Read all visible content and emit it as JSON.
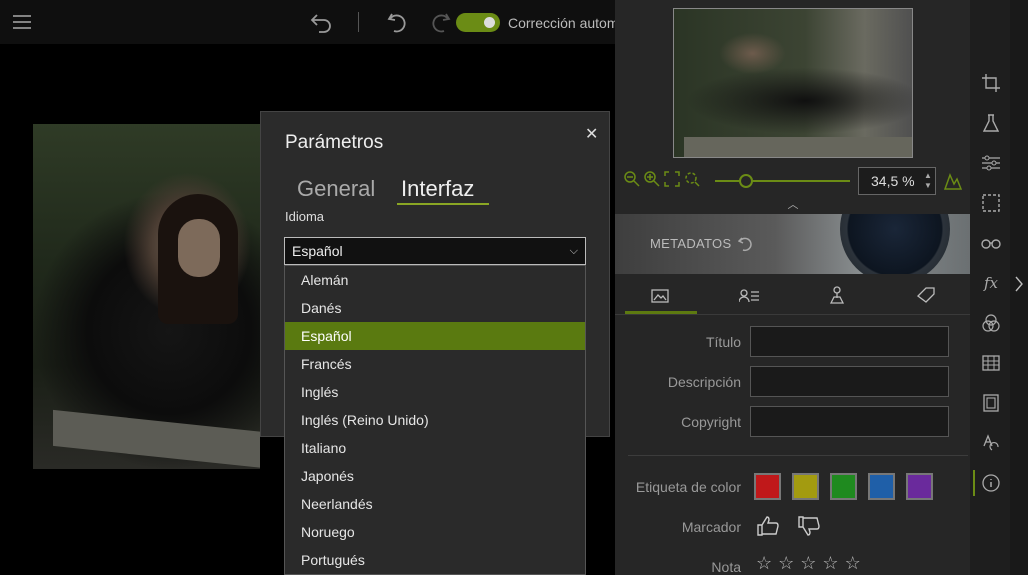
{
  "toolbar": {
    "auto_correction_label": "Corrección autom",
    "auto_correction_on": true,
    "accent": "#6b8c15"
  },
  "navigator": {
    "zoom_value": "34,5 %"
  },
  "metadata": {
    "banner_label": "METADATOS",
    "fields": [
      {
        "label": "Título",
        "value": ""
      },
      {
        "label": "Descripción",
        "value": ""
      },
      {
        "label": "Copyright",
        "value": ""
      }
    ],
    "color_label_title": "Etiqueta de color",
    "color_labels": [
      "#c0181a",
      "#a39b10",
      "#1f8a1f",
      "#1f5fa8",
      "#6a2a9c"
    ],
    "marker_label": "Marcador",
    "rating_label": "Nota",
    "rating_stars": 5
  },
  "dialog": {
    "title": "Parámetros",
    "tabs": [
      {
        "label": "General",
        "active": false
      },
      {
        "label": "Interfaz",
        "active": true
      }
    ],
    "language_label": "Idioma",
    "language_selected": "Español",
    "language_options": [
      "Alemán",
      "Danés",
      "Español",
      "Francés",
      "Inglés",
      "Inglés (Reino Unido)",
      "Italiano",
      "Japonés",
      "Neerlandés",
      "Noruego",
      "Portugués"
    ]
  }
}
